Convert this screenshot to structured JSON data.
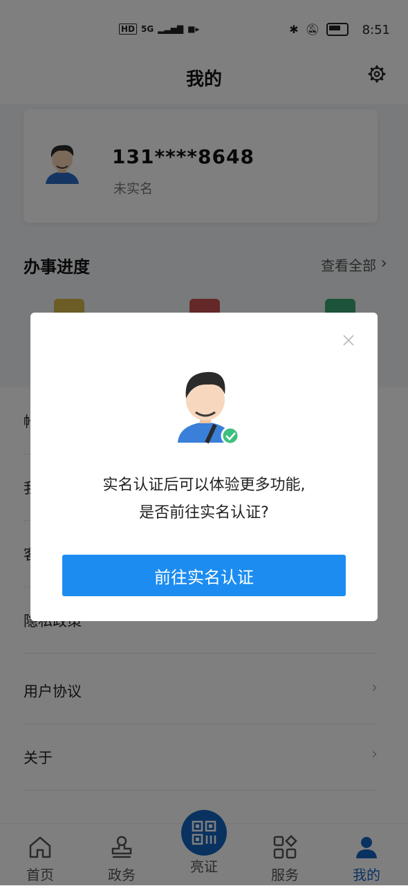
{
  "status_bar": {
    "time": "8:51",
    "left_icons": [
      "HD",
      "5G",
      "signal",
      "video"
    ],
    "right_icons": [
      "bluetooth-icon",
      "mute-icon",
      "battery-icon"
    ]
  },
  "header": {
    "title": "我的"
  },
  "profile": {
    "phone": "131****8648",
    "realname_status": "未实名"
  },
  "progress": {
    "title": "办事进度",
    "view_all": "查看全部",
    "icon_colors": [
      "#d9b84a",
      "#c85050",
      "#3aa675"
    ]
  },
  "list": {
    "items": [
      {
        "label": "帐号"
      },
      {
        "label": "我"
      },
      {
        "label": "客"
      },
      {
        "label": "隐私政策"
      },
      {
        "label": "用户协议"
      },
      {
        "label": "关于"
      }
    ]
  },
  "bottom_nav": {
    "items": [
      {
        "label": "首页"
      },
      {
        "label": "政务"
      },
      {
        "label": "亮证"
      },
      {
        "label": "服务"
      },
      {
        "label": "我的"
      }
    ],
    "active_color": "#1565c0"
  },
  "dialog": {
    "message_line1": "实名认证后可以体验更多功能,",
    "message_line2": "是否前往实名认证?",
    "cta_label": "前往实名认证",
    "cta_color": "#1c8cf0"
  }
}
